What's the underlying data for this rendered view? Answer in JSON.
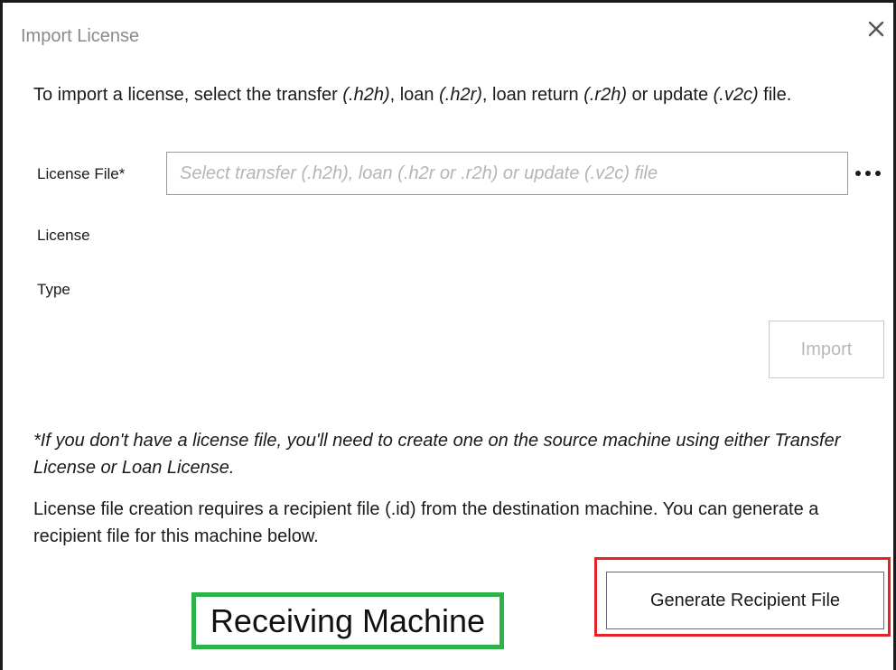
{
  "dialog": {
    "title": "Import License",
    "close_icon": "close-icon"
  },
  "intro": {
    "text_1": "To import a license, select the transfer ",
    "ext_h2h": "(.h2h)",
    "text_2": ", loan ",
    "ext_h2r": "(.h2r)",
    "text_3": ", loan return ",
    "ext_r2h": "(.r2h)",
    "text_4": " or update ",
    "ext_v2c": "(.v2c)",
    "text_5": " file."
  },
  "form": {
    "license_file_label": "License File*",
    "license_file_value": "",
    "license_file_placeholder": "Select transfer (.h2h), loan (.h2r or .r2h) or update (.v2c) file",
    "browse_icon": "more-dots-icon",
    "license_label": "License",
    "type_label": "Type",
    "import_button": "Import"
  },
  "note": {
    "italic_text": "*If you don't have a license file, you'll need to create one on the source machine using either Transfer License or Loan License."
  },
  "description": {
    "text": "License file creation requires a recipient file (.id) from the destination machine. You can generate a recipient file for this machine below."
  },
  "actions": {
    "generate_button": "Generate Recipient File"
  },
  "annotations": {
    "receiving_label": "Receiving Machine",
    "highlight_red": "#e8202a",
    "highlight_green": "#2bb34a"
  }
}
